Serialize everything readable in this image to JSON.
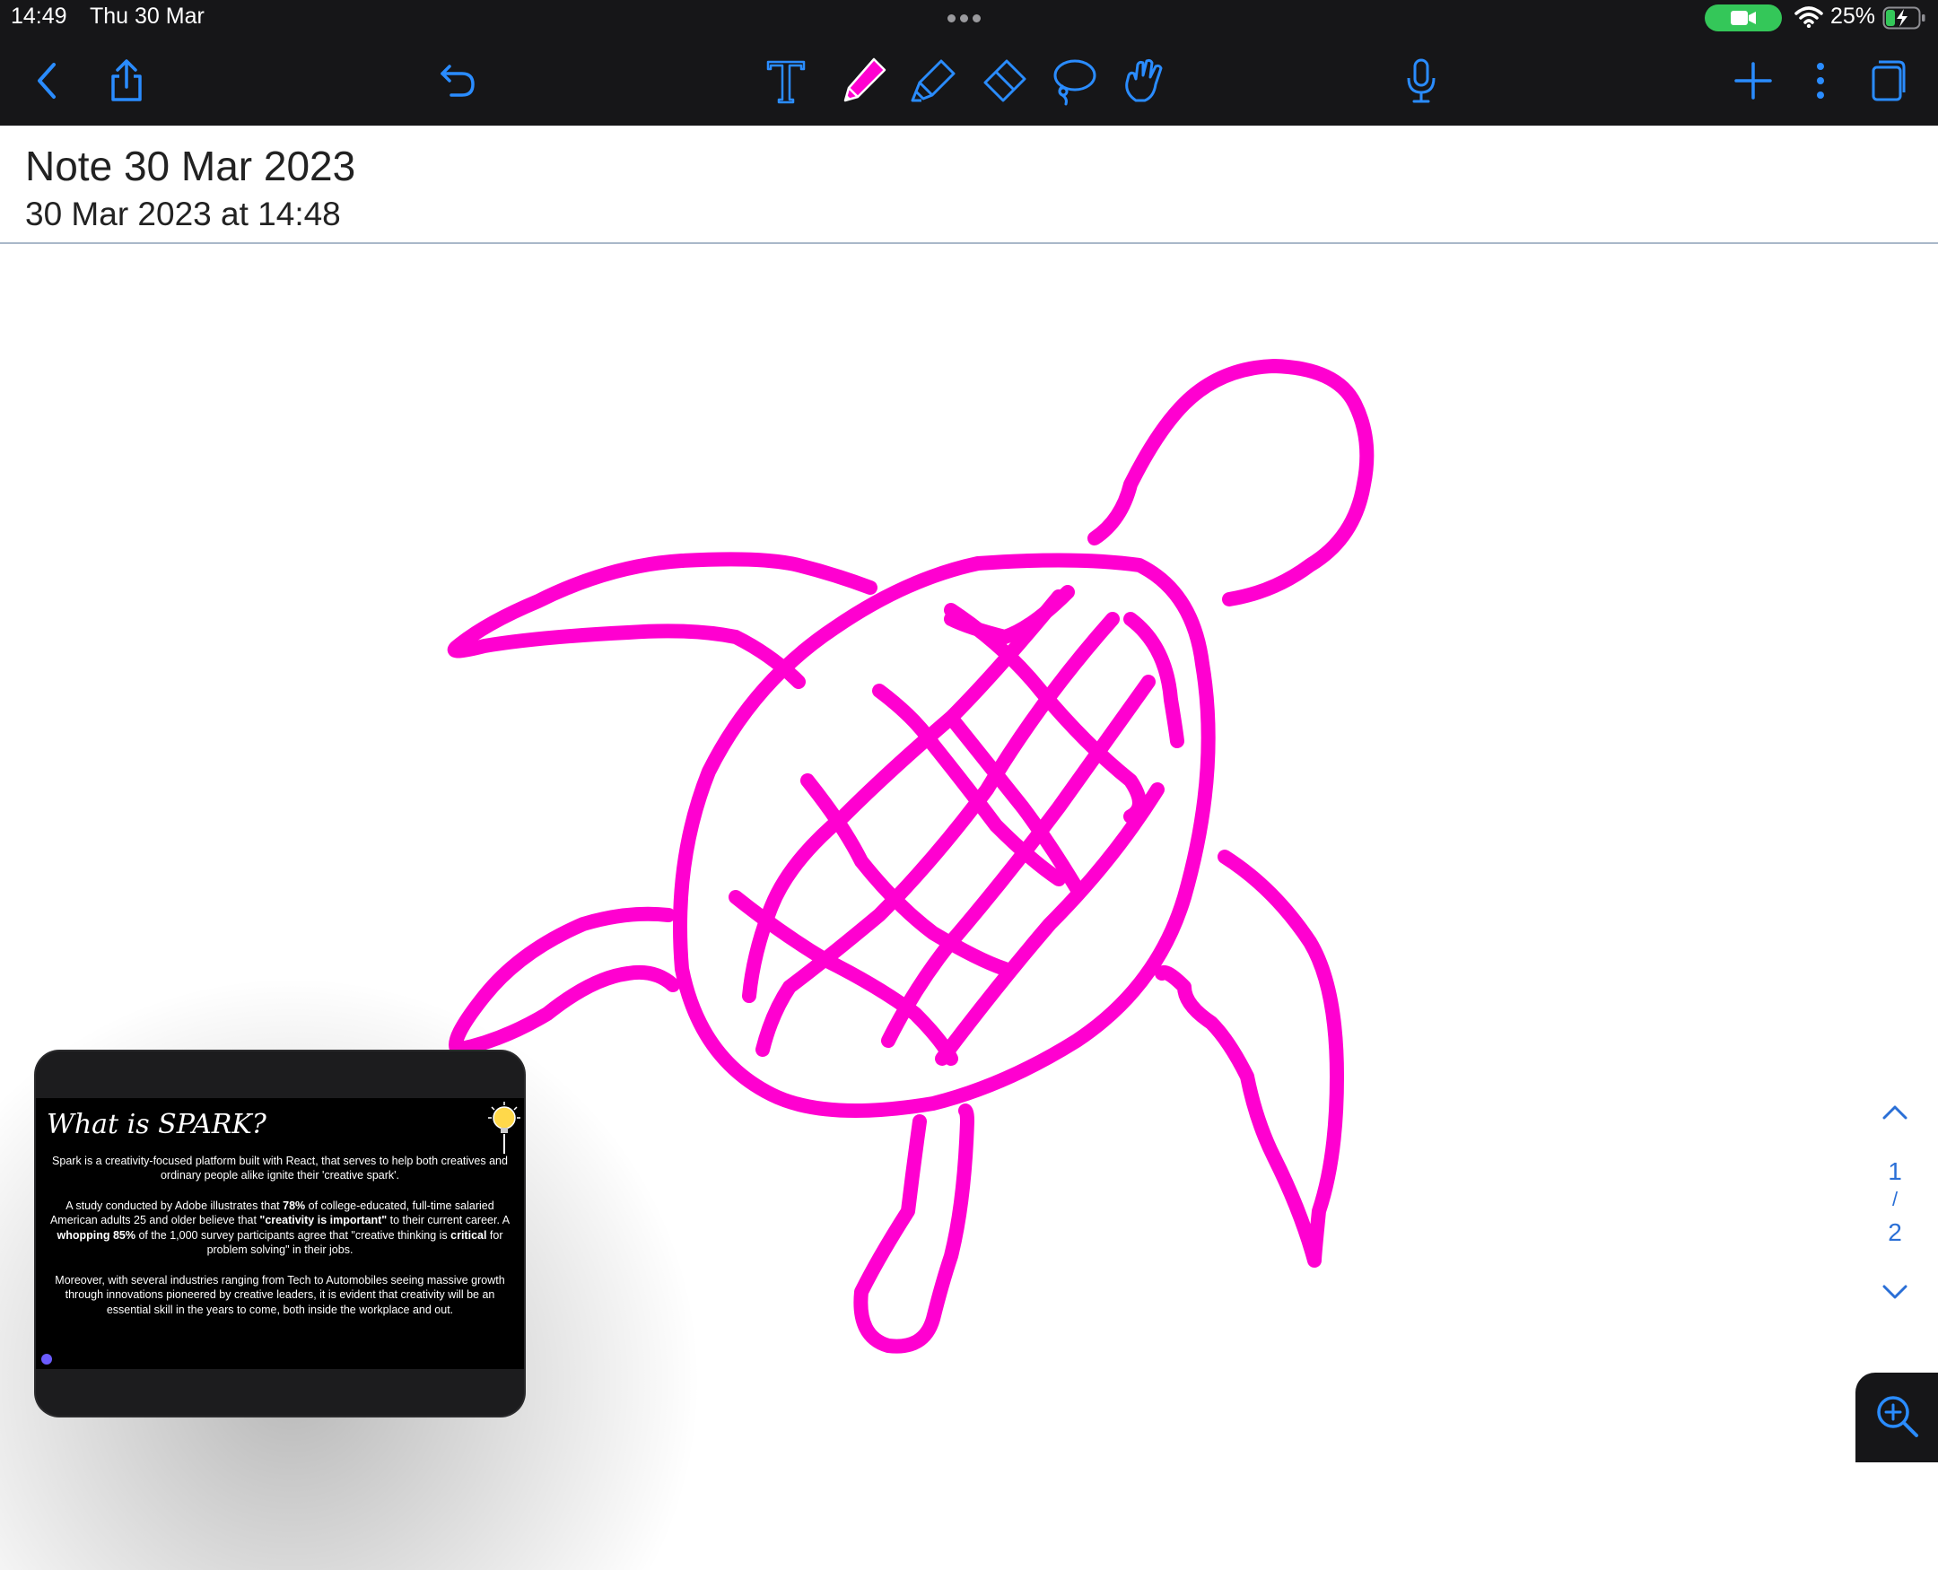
{
  "status_bar": {
    "time": "14:49",
    "date": "Thu 30 Mar",
    "battery": "25%"
  },
  "toolbar": {
    "icons": [
      "chevron-left-icon",
      "share-icon",
      "undo-icon",
      "text-tool-icon",
      "pen-icon",
      "highlighter-icon",
      "eraser-icon",
      "lasso-icon",
      "hand-icon",
      "microphone-icon",
      "plus-icon",
      "more-icon",
      "pages-icon"
    ],
    "accent": "#2a8cff",
    "pen_color": "#ff00d0"
  },
  "note": {
    "title": "Note 30 Mar 2023",
    "date": "30 Mar 2023 at 14:48"
  },
  "drawing": {
    "stroke_color": "#ff00d0",
    "subject": "turtle"
  },
  "pip": {
    "heading": "What is SPARK?",
    "para1": "Spark is a creativity-focused platform built with React, that serves to help both creatives and ordinary people alike ignite their 'creative spark'.",
    "para2_a": "A study conducted by Adobe illustrates that ",
    "para2_b": "78%",
    "para2_c": " of college-educated, full-time salaried American adults 25 and older believe that ",
    "para2_d": "\"creativity is important\"",
    "para2_e": " to their current career. A ",
    "para2_f": "whopping 85%",
    "para2_g": " of the 1,000 survey participants agree that \"creative thinking is ",
    "para2_h": "critical",
    "para2_i": " for problem solving\" in their jobs.",
    "para3": "Moreover, with several industries ranging from Tech to Automobiles seeing massive growth through innovations pioneered by creative leaders, it is evident that creativity will be an essential skill in the years to come, both inside the workplace and out."
  },
  "page_nav": {
    "current": "1",
    "separator": "/",
    "total": "2"
  }
}
